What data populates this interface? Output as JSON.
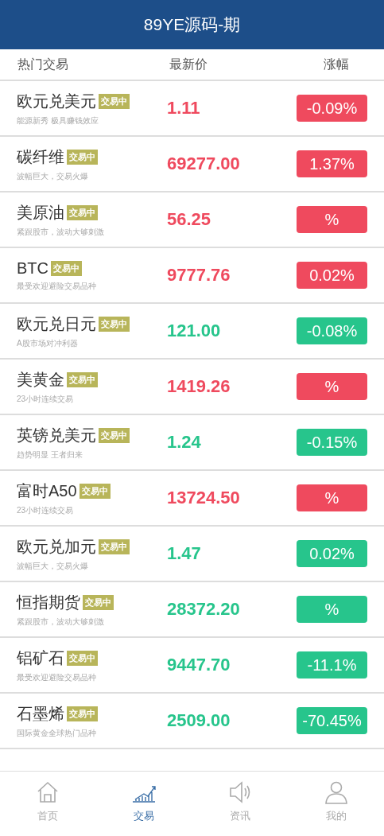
{
  "header": {
    "title": "89YE源码-期"
  },
  "columns": [
    "热门交易",
    "最新价",
    "涨幅"
  ],
  "rows": [
    {
      "name": "欧元兑美元",
      "tag": "交易中",
      "desc": "能源新秀 极具赚钱效应",
      "price": "1.11",
      "change": "-0.09%",
      "color": "#ef4a5e"
    },
    {
      "name": "碳纤维",
      "tag": "交易中",
      "desc": "波幅巨大，交易火爆",
      "price": "69277.00",
      "change": "1.37%",
      "color": "#ef4a5e"
    },
    {
      "name": "美原油",
      "tag": "交易中",
      "desc": "紧跟股市，波动大够刺激",
      "price": "56.25",
      "change": "%",
      "color": "#ef4a5e"
    },
    {
      "name": "BTC",
      "tag": "交易中",
      "desc": "最受欢迎避险交易品种",
      "price": "9777.76",
      "change": "0.02%",
      "color": "#ef4a5e"
    },
    {
      "name": "欧元兑日元",
      "tag": "交易中",
      "desc": "A股市场对冲利器",
      "price": "121.00",
      "change": "-0.08%",
      "color": "#27c58c"
    },
    {
      "name": "美黄金",
      "tag": "交易中",
      "desc": "23小时连续交易",
      "price": "1419.26",
      "change": "%",
      "color": "#ef4a5e"
    },
    {
      "name": "英镑兑美元",
      "tag": "交易中",
      "desc": "趋势明显 王者归来",
      "price": "1.24",
      "change": "-0.15%",
      "color": "#27c58c"
    },
    {
      "name": "富时A50",
      "tag": "交易中",
      "desc": "23小时连续交易",
      "price": "13724.50",
      "change": "%",
      "color": "#ef4a5e"
    },
    {
      "name": "欧元兑加元",
      "tag": "交易中",
      "desc": "波幅巨大，交易火爆",
      "price": "1.47",
      "change": "0.02%",
      "color": "#27c58c"
    },
    {
      "name": "恒指期货",
      "tag": "交易中",
      "desc": "紧跟股市，波动大够刺激",
      "price": "28372.20",
      "change": "%",
      "color": "#27c58c"
    },
    {
      "name": "铝矿石",
      "tag": "交易中",
      "desc": "最受欢迎避险交易品种",
      "price": "9447.70",
      "change": "-11.1%",
      "color": "#27c58c"
    },
    {
      "name": "石墨烯",
      "tag": "交易中",
      "desc": "国际黄金全球热门品种",
      "price": "2509.00",
      "change": "-70.45%",
      "color": "#27c58c"
    }
  ],
  "tabbar": [
    {
      "label": "首页",
      "selected": false
    },
    {
      "label": "交易",
      "selected": true
    },
    {
      "label": "资讯",
      "selected": false
    },
    {
      "label": "我的",
      "selected": false
    }
  ]
}
